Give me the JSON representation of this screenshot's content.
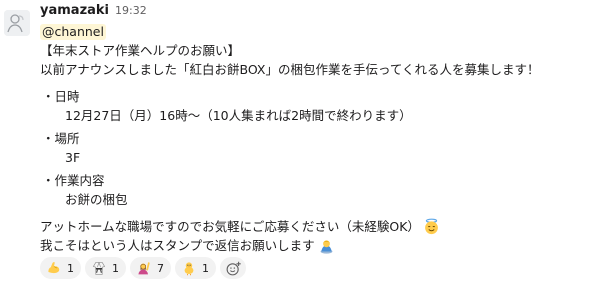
{
  "message": {
    "username": "yamazaki",
    "timestamp": "19:32",
    "mention": "@channel",
    "title": "【年末ストア作業ヘルプのお願い】",
    "intro": "以前アナウンスしました「紅白お餅BOX」の梱包作業を手伝ってくれる人を募集します！",
    "sections": [
      {
        "heading": "・日時",
        "detail": "12月27日（月）16時〜（10人集まれば2時間で終わります）"
      },
      {
        "heading": "・場所",
        "detail": "3F"
      },
      {
        "heading": "・作業内容",
        "detail": "お餅の梱包"
      }
    ],
    "closing_line_1": "アットホームな職場ですのでお気軽にご応募ください（未経験OK）",
    "closing_line_1_emoji": "smiling-face-with-halo-icon",
    "closing_line_2": "我こそはという人はスタンプで返信お願いします",
    "closing_line_2_emoji": "person-bowing-icon"
  },
  "reactions": [
    {
      "emoji": "flexed-biceps-icon",
      "count": "1"
    },
    {
      "emoji": "martial-arts-uniform-icon",
      "count": "1"
    },
    {
      "emoji": "person-raising-hand-icon",
      "count": "7"
    },
    {
      "emoji": "baby-chick-icon",
      "count": "1"
    }
  ],
  "add_reaction_icon": "add-reaction-icon",
  "colors": {
    "mention_bg": "#fef6d5",
    "reaction_bg": "#f2f2f2",
    "text": "#1d1c1d",
    "timestamp": "#616061"
  }
}
